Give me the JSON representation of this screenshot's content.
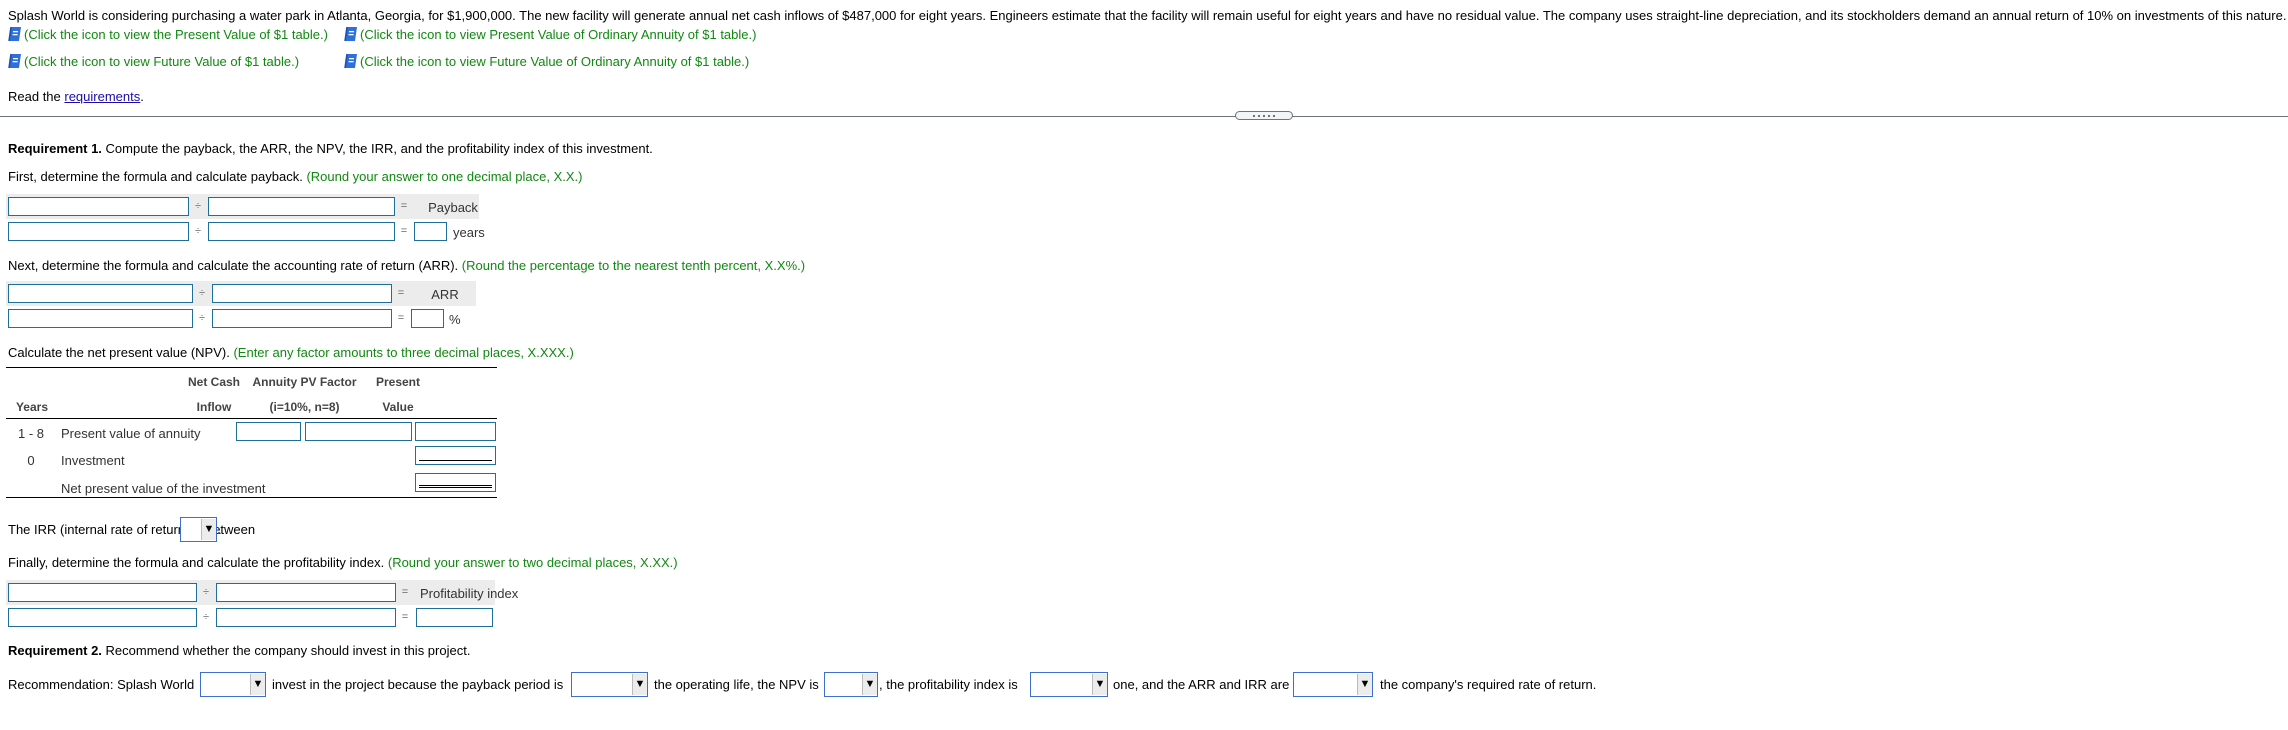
{
  "problem": {
    "statement": "Splash World is considering purchasing a water park in Atlanta, Georgia, for $1,900,000. The new facility will generate annual net cash inflows of $487,000 for eight years. Engineers estimate that the facility will remain useful for eight years and have no residual value. The company uses straight-line depreciation, and its stockholders demand an annual return of 10% on investments of this nature.",
    "table_links": [
      {
        "icon": "book-icon",
        "label": "(Click the icon to view the Present Value of $1 table.)"
      },
      {
        "icon": "book-icon",
        "label": "(Click the icon to view Present Value of Ordinary Annuity of $1 table.)"
      },
      {
        "icon": "book-icon",
        "label": "(Click the icon to view Future Value of $1 table.)"
      },
      {
        "icon": "book-icon",
        "label": "(Click the icon to view Future Value of Ordinary Annuity of $1 table.)"
      }
    ],
    "read_prefix": "Read the ",
    "read_link": "requirements",
    "read_suffix": "."
  },
  "req1": {
    "heading_bold": "Requirement 1.",
    "heading_text": " Compute the payback, the ARR, the NPV, the IRR, and the profitability index of this investment.",
    "payback": {
      "instruction": "First, determine the formula and calculate payback.",
      "hint": "(Round your answer to one decimal place, X.X.)",
      "operator_div": "÷",
      "operator_eq": "=",
      "result_label": "Payback",
      "unit": "years",
      "row1": {
        "left": "",
        "right": ""
      },
      "row2": {
        "left": "",
        "right": "",
        "result": ""
      }
    },
    "arr": {
      "instruction": "Next, determine the formula and calculate the accounting rate of return (ARR).",
      "hint": "(Round the percentage to the nearest tenth percent, X.X%.)",
      "operator_div": "÷",
      "operator_eq": "=",
      "result_label": "ARR",
      "unit": "%",
      "row1": {
        "left": "",
        "right": ""
      },
      "row2": {
        "left": "",
        "right": "",
        "result": ""
      }
    },
    "npv": {
      "instruction": "Calculate the net present value (NPV).",
      "hint": "(Enter any factor amounts to three decimal places, X.XXX.)",
      "headers": {
        "years": "Years",
        "net_cash_1": "Net Cash",
        "net_cash_2": "Inflow",
        "factor_1": "Annuity PV Factor",
        "factor_2": "(i=10%, n=8)",
        "pv_1": "Present",
        "pv_2": "Value"
      },
      "rows": [
        {
          "years": "1 - 8",
          "label": "Present value of annuity",
          "net_cash": "",
          "factor": "",
          "pv": ""
        },
        {
          "years": "0",
          "label": "Investment",
          "pv": ""
        },
        {
          "years": "",
          "label": "Net present value of the investment",
          "pv": ""
        }
      ]
    },
    "irr": {
      "prefix": "The IRR (internal rate of return) is between",
      "selected": "",
      "suffix": "."
    },
    "pi": {
      "instruction": "Finally, determine the formula and calculate the profitability index.",
      "hint": "(Round your answer to two decimal places, X.XX.)",
      "operator_div": "÷",
      "operator_eq": "=",
      "result_label": "Profitability index",
      "row1": {
        "left": "",
        "right": ""
      },
      "row2": {
        "left": "",
        "right": "",
        "result": ""
      }
    }
  },
  "req2": {
    "heading_bold": "Requirement 2.",
    "heading_text": " Recommend whether the company should invest in this project.",
    "sentence": [
      "Recommendation: Splash World",
      "invest in the project because the payback period is",
      "the operating life, the NPV is",
      ", the profitability index is",
      "one, and the ARR and IRR are",
      "the company's required rate of return."
    ],
    "selects": [
      "",
      "",
      "",
      "",
      ""
    ],
    "dropdown_arrow": "▼"
  },
  "colors": {
    "hint_green": "#118811",
    "input_border": "#1f6f99",
    "select_border": "#3e6fcf",
    "link_blue": "#1a0dab"
  }
}
